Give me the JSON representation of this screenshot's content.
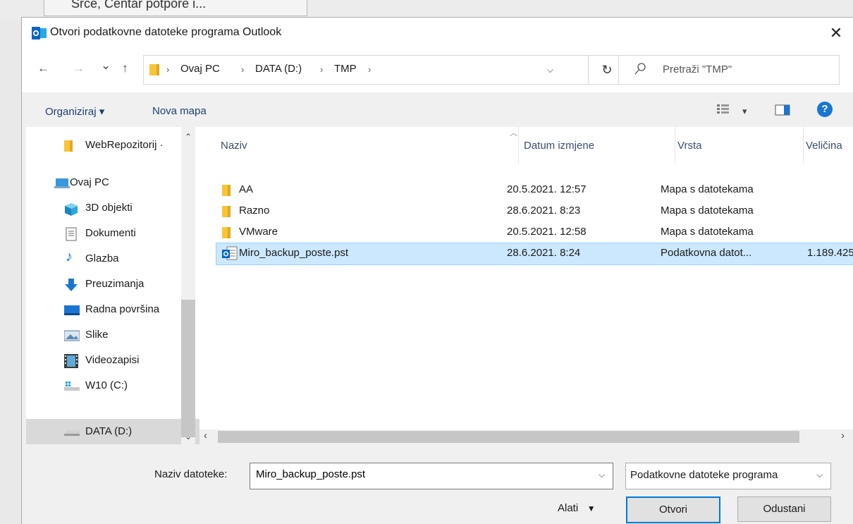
{
  "background": {
    "tab_text": "Srce, Centar potpore i..."
  },
  "window": {
    "title": "Otvori podatkovne datoteke programa Outlook",
    "close": "✕"
  },
  "nav": {
    "back": "←",
    "forward": "→",
    "recent": "⌄",
    "up": "↑",
    "breadcrumb": [
      "Ovaj PC",
      "DATA (D:)",
      "TMP"
    ],
    "separator": "›",
    "refresh": "↻",
    "search_placeholder": "Pretraži \"TMP\""
  },
  "toolbar": {
    "organize": "Organiziraj ▾",
    "new_folder": "Nova mapa",
    "view_dd": "▾",
    "help": "?"
  },
  "sidebar": {
    "items": [
      {
        "label": "WebRepozitorij · ",
        "icon": "folder-icon"
      },
      {
        "label": "Ovaj PC",
        "icon": "computer-icon"
      },
      {
        "label": "3D objekti",
        "icon": "3d-objects-icon"
      },
      {
        "label": "Dokumenti",
        "icon": "documents-icon"
      },
      {
        "label": "Glazba",
        "icon": "music-icon"
      },
      {
        "label": "Preuzimanja",
        "icon": "downloads-icon"
      },
      {
        "label": "Radna površina",
        "icon": "desktop-icon"
      },
      {
        "label": "Slike",
        "icon": "pictures-icon"
      },
      {
        "label": "Videozapisi",
        "icon": "videos-icon"
      },
      {
        "label": "W10 (C:)",
        "icon": "windows-drive-icon"
      },
      {
        "label": "DATA (D:)",
        "icon": "drive-icon",
        "selected": true
      }
    ]
  },
  "columns": [
    "Naziv",
    "Datum izmjene",
    "Vrsta",
    "Veličina"
  ],
  "files": [
    {
      "name": "AA",
      "date": "20.5.2021. 12:57",
      "type": "Mapa s datotekama",
      "size": ""
    },
    {
      "name": "Razno",
      "date": "28.6.2021. 8:23",
      "type": "Mapa s datotekama",
      "size": ""
    },
    {
      "name": "VMware",
      "date": "20.5.2021. 12:58",
      "type": "Mapa s datotekama",
      "size": ""
    },
    {
      "name": "Miro_backup_poste.pst",
      "date": "28.6.2021. 8:24",
      "type": "Podatkovna datot...",
      "size": "1.189.425",
      "selected": true
    }
  ],
  "bottom": {
    "filename_label": "Naziv datoteke:",
    "filename_value": "Miro_backup_poste.pst",
    "filetype": "Podatkovne datoteke programa",
    "tools": "Alati",
    "tools_dd": "▼",
    "open": "Otvori",
    "cancel": "Odustani"
  },
  "colors": {
    "accent": "#0078d7",
    "selected_row": "#cce8ff",
    "folder": "#f8c537"
  }
}
